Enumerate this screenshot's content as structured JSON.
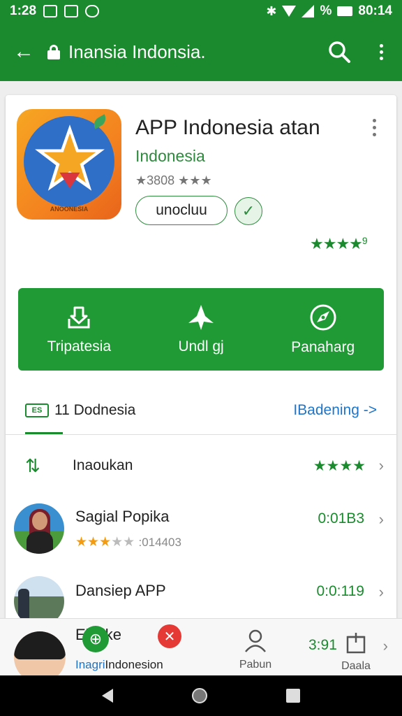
{
  "status_bar": {
    "time": "1:28",
    "battery": "%",
    "clock": "80:14"
  },
  "app_bar": {
    "title": "Inansia Indonsia."
  },
  "app": {
    "icon_text": "ANOONESIA",
    "title": "APP Indonesia atan",
    "developer": "Indonesia",
    "rating_line": "★3808 ★★★",
    "pill_label": "unocluu",
    "rating_stars": "★★★★",
    "rating_badge": "9"
  },
  "actions": [
    {
      "label": "Tripatesia",
      "icon": "download-icon"
    },
    {
      "label": "Undl gj",
      "icon": "star-icon"
    },
    {
      "label": "Panaharg",
      "icon": "compass-icon"
    }
  ],
  "section": {
    "badge": "ES",
    "title": "11 Dodnesia",
    "link": "IBadening ->"
  },
  "rows": [
    {
      "label": "Inaoukan",
      "stars": "★★★★"
    },
    {
      "name": "Sagial Popika",
      "stars_filled": "★★★",
      "stars_empty": "★★",
      "count": ":014403",
      "value": "0:01B3"
    },
    {
      "name": "Dansiep APP",
      "value": "0:0:119"
    }
  ],
  "bottom": {
    "brand": "Ebyike",
    "sub_prefix": "Inagri",
    "sub_rest": "Indonesion",
    "tab_person": "Pabun",
    "value": "3:91",
    "tab_box": "Daala"
  },
  "colors": {
    "primary": "#1b8a2e",
    "action_bg": "#1f9a35",
    "link": "#1e74c8",
    "star_gold": "#f39c12"
  }
}
